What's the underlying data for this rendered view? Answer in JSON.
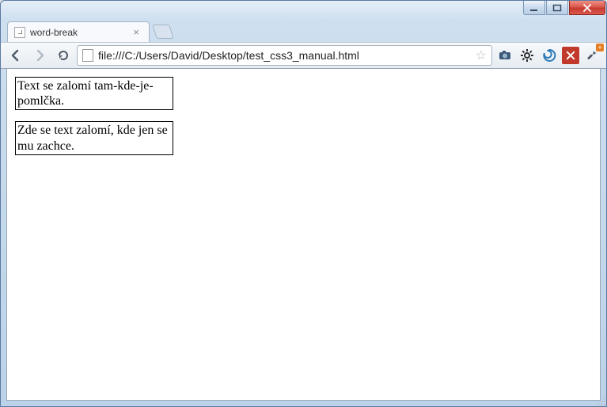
{
  "window": {
    "controls": {
      "min": "minimize",
      "max": "maximize",
      "close": "close"
    }
  },
  "tab": {
    "title": "word-break"
  },
  "toolbar": {
    "url": "file:///C:/Users/David/Desktop/test_css3_manual.html"
  },
  "content": {
    "box1": "Text se zalomí tam-kde-je-pomlčka.",
    "box2": "Zde se text zalomí, kde jen se mu zachce."
  }
}
